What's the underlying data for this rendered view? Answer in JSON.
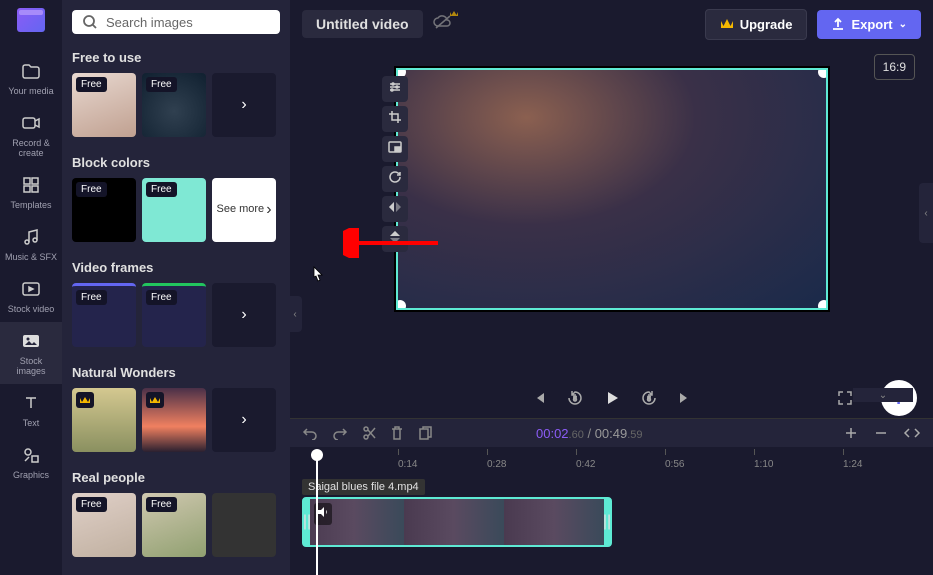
{
  "header": {
    "title": "Untitled video",
    "upgrade_label": "Upgrade",
    "export_label": "Export",
    "aspect_ratio": "16:9"
  },
  "search": {
    "placeholder": "Search images"
  },
  "rail": {
    "your_media": "Your media",
    "record_create": "Record & create",
    "templates": "Templates",
    "music_sfx": "Music & SFX",
    "stock_video": "Stock video",
    "stock_images": "Stock images",
    "text": "Text",
    "graphics": "Graphics"
  },
  "sections": {
    "free_to_use": {
      "title": "Free to use",
      "badges": [
        "Free",
        "Free"
      ]
    },
    "block_colors": {
      "title": "Block colors",
      "badges": [
        "Free",
        "Free"
      ],
      "see_more": "See more"
    },
    "video_frames": {
      "title": "Video frames",
      "badges": [
        "Free",
        "Free"
      ]
    },
    "natural_wonders": {
      "title": "Natural Wonders"
    },
    "real_people": {
      "title": "Real people",
      "badges": [
        "Free",
        "Free"
      ]
    }
  },
  "playback": {
    "current_time": "00:02",
    "current_frames": ".60",
    "total_time": "00:49",
    "total_frames": ".59"
  },
  "ruler": {
    "marks": [
      "0:14",
      "0:28",
      "0:42",
      "0:56",
      "1:10",
      "1:24"
    ]
  },
  "clip": {
    "name": "Saigal blues file 4.mp4"
  }
}
